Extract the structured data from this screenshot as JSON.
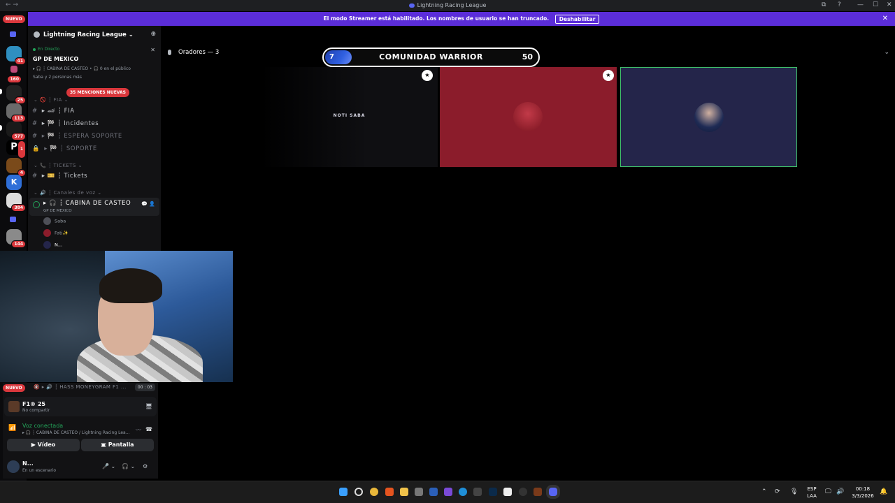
{
  "window": {
    "title": "Lightning Racing League",
    "nav": "← →",
    "controls": [
      "⧉",
      "?",
      "—",
      "☐",
      "✕"
    ]
  },
  "banner": {
    "text": "El modo Streamer está habilitado. Los nombres de usuario se han truncado.",
    "button": "Deshabilitar",
    "close": "✕"
  },
  "rail": {
    "nuevo": "NUEVO",
    "badges": [
      "41",
      "160",
      "25",
      "113",
      "577",
      "1",
      "4",
      "384",
      "144"
    ],
    "logo_letters": {
      "p": "P",
      "k": "K"
    }
  },
  "server": {
    "name": "Lightning Racing League",
    "dropdown": "⌄",
    "invite": "⊕"
  },
  "live": {
    "status": "En Directo",
    "title": "GP DE MEXICO",
    "subtitle": "▸ 🎧 ┆ CABINA DE CASTEO • 🎧 0 en el público",
    "people": "Saba y 2 personas más",
    "close": "✕"
  },
  "mentions": "35 MENCIONES NUEVAS",
  "channels": {
    "cat_fia": "⌄ 🚫 ┆ FIA ⌄",
    "fia": "▸ 🏎 ┆ FIA",
    "incidentes": "▸ 🏁 ┆ Incidentes",
    "espera": "▸ 🏁 ┆ ESPERA SOPORTE",
    "soporte": "▸ 🏁 ┆ SOPORTE",
    "cat_tickets": "⌄ 📞 ┆ TICKETS ⌄",
    "tickets": "▸ 🎫 ┆ Tickets",
    "cat_voz": "⌄ 🔊 ┆ Canales de voz ⌄",
    "cabina": "▸ 🎧 ┆ CABINA DE CASTEO",
    "cabina_sub": "GP DE MEXICO",
    "cabina_acts": "💬 👤"
  },
  "voice_users": [
    "Saba",
    "Fati✨",
    "N..."
  ],
  "now_playing": {
    "nuevo": "NUEVO",
    "channel": "🔇 ▸ 🔊 ┆ HASS MONEYGRAM F1 ...",
    "timer": "00 : 03"
  },
  "activity": {
    "game": "F1® 25",
    "status": "No compartir",
    "icon": "🖥"
  },
  "voice": {
    "status": "Voz conectada",
    "location": "▸ 🎧 ┆ CABINA DE CASTEO / Lightning Racing Lea...",
    "icon": "📶",
    "noise": "〰",
    "disconnect": "☎"
  },
  "buttons": {
    "video": "Vídeo",
    "screen": "Pantalla"
  },
  "user": {
    "name": "N...",
    "status": "En un escenario",
    "mic": "🎤 ⌄",
    "headset": "🎧 ⌄",
    "settings": "⚙"
  },
  "stage": {
    "speakers": "Oradores — 3",
    "collapse": "⌄"
  },
  "scoreboard": {
    "left": "7",
    "team": "COMUNIDAD WARRIOR",
    "right": "50"
  },
  "tiles": [
    {
      "label": "NOTI SABA",
      "crown": "★"
    },
    {
      "label": "",
      "crown": "★"
    },
    {
      "label": "",
      "crown": ""
    }
  ],
  "taskbar": {
    "lang": "ESP",
    "region": "LAA",
    "time": "00:18",
    "date": "3/3/2026",
    "tray_up": "⌃",
    "tray_sync": "⟳",
    "tray_mic": "🎙",
    "tray_display": "🖵",
    "tray_volume": "🔊",
    "tray_notify": "🔔"
  },
  "colors": {
    "accent": "#5865f2",
    "banner": "#5b2dd9",
    "red": "#da373c",
    "green": "#23a55a"
  }
}
